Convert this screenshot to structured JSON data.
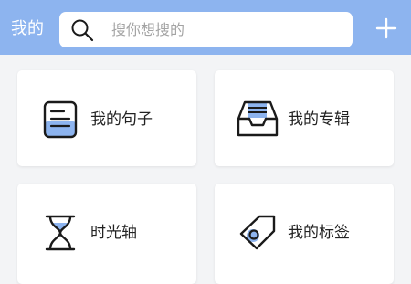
{
  "header": {
    "title": "我的",
    "search_placeholder": "搜你想搜的",
    "add_icon": "plus-icon",
    "search_icon": "search-icon"
  },
  "cards": [
    {
      "label": "我的句子",
      "icon": "document-icon"
    },
    {
      "label": "我的专辑",
      "icon": "inbox-tray-icon"
    },
    {
      "label": "时光轴",
      "icon": "hourglass-icon"
    },
    {
      "label": "我的标签",
      "icon": "tag-icon"
    }
  ],
  "colors": {
    "header_bg": "#8db4ef",
    "accent": "#8db4ef",
    "icon_stroke": "#1a1a1a"
  }
}
